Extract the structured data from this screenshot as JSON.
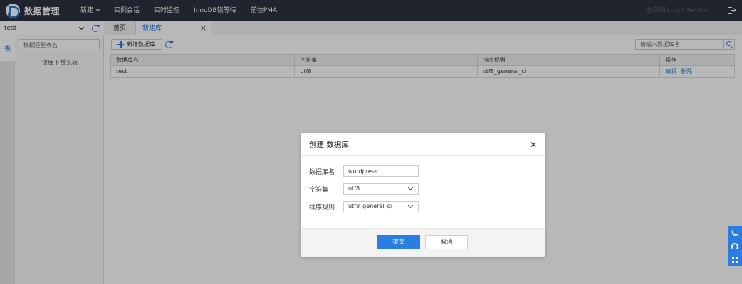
{
  "topbar": {
    "logo_text": "数据管理",
    "nav": [
      {
        "label": "新建",
        "has_dropdown": true
      },
      {
        "label": "实例会话"
      },
      {
        "label": "实时监控"
      },
      {
        "label": "InnoDB锁等待"
      },
      {
        "label": "前往PMA"
      }
    ],
    "instance_label": "主实例 cdb-44e40otr"
  },
  "sidebar": {
    "selected_db": "test",
    "vertical_tab": "表",
    "filter_placeholder": "模糊匹配表名",
    "empty_message": "该库下暂无表"
  },
  "tabs": [
    {
      "label": "首页",
      "active": false
    },
    {
      "label": "新建库",
      "active": true,
      "closable": true
    }
  ],
  "toolbar": {
    "new_db_label": "新增数据库",
    "search_placeholder": "请输入数据库名"
  },
  "table": {
    "headers": [
      "数据库名",
      "字符集",
      "排序规则",
      "操作"
    ],
    "rows": [
      {
        "name": "test",
        "charset": "utf8",
        "collation": "utf8_general_ci",
        "actions": [
          "编辑",
          "删除"
        ]
      }
    ]
  },
  "modal": {
    "title": "创建 数据库",
    "fields": [
      {
        "label": "数据库名",
        "value": "wordpress"
      },
      {
        "label": "字符集",
        "value": "utf8"
      },
      {
        "label": "排序规则",
        "value": "utf8_general_ci"
      }
    ],
    "submit_label": "提交",
    "cancel_label": "取消"
  },
  "colors": {
    "accent": "#2a7de1",
    "topbar_bg": "#2b3340"
  }
}
